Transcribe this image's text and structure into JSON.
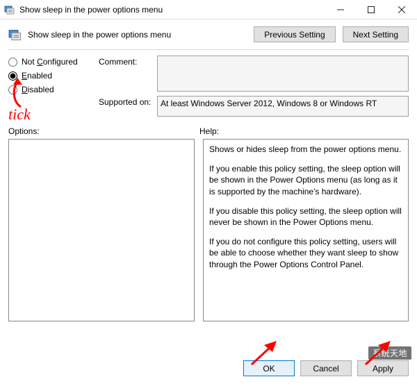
{
  "window": {
    "title": "Show sleep in the power options menu"
  },
  "header": {
    "title": "Show sleep in the power options menu",
    "previous": "Previous Setting",
    "next": "Next Setting"
  },
  "radios": {
    "not_configured": "Not Configured",
    "enabled": "Enabled",
    "disabled": "Disabled",
    "selected": "enabled"
  },
  "fields": {
    "comment_label": "Comment:",
    "comment_value": "",
    "supported_label": "Supported on:",
    "supported_value": "At least Windows Server 2012, Windows 8 or Windows RT"
  },
  "sections": {
    "options": "Options:",
    "help": "Help:"
  },
  "help": {
    "p1": "Shows or hides sleep from the power options menu.",
    "p2": "If you enable this policy setting, the sleep option will be shown in the Power Options menu (as long as it is supported by the machine's hardware).",
    "p3": "If you disable this policy setting, the sleep option will never be shown in the Power Options menu.",
    "p4": "If you do not configure this policy setting, users will be able to choose whether they want sleep to show through the Power Options Control Panel."
  },
  "buttons": {
    "ok": "OK",
    "cancel": "Cancel",
    "apply": "Apply"
  },
  "annotations": {
    "tick": "tick"
  },
  "watermark": "系统天地"
}
